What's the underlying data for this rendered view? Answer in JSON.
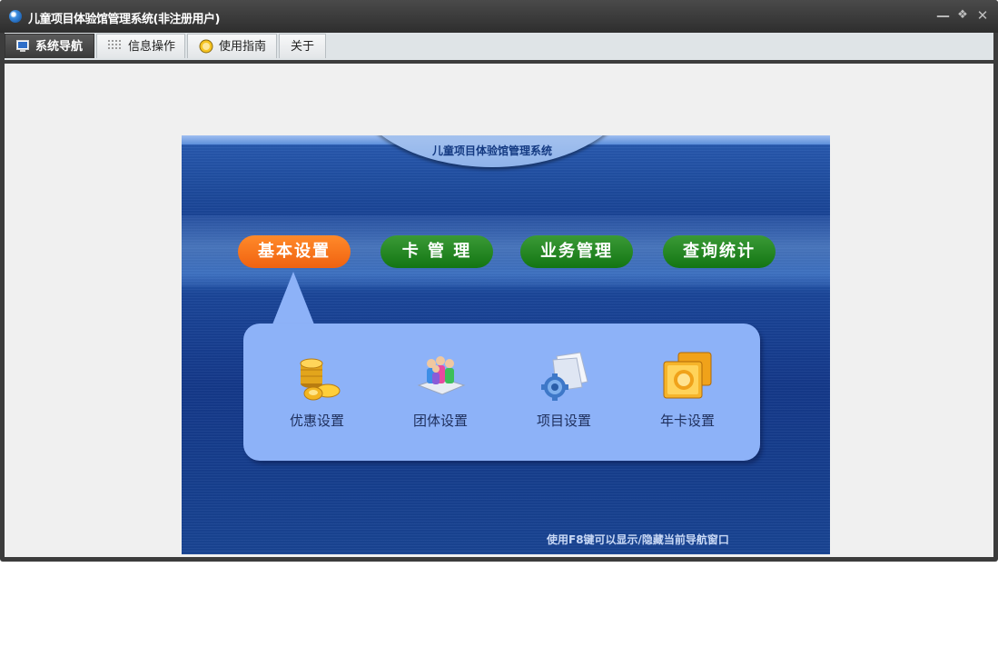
{
  "window": {
    "title": "儿童项目体验馆管理系统(非注册用户)"
  },
  "tabs": [
    {
      "label": "系统导航",
      "icon": "monitor-icon",
      "active": true
    },
    {
      "label": "信息操作",
      "icon": "grid-icon",
      "active": false
    },
    {
      "label": "使用指南",
      "icon": "help-icon",
      "active": false
    },
    {
      "label": "关于",
      "icon": "",
      "active": false
    }
  ],
  "panel": {
    "header": "儿童项目体验馆管理系统",
    "menu": [
      {
        "label": "基本设置",
        "active": true
      },
      {
        "label": "卡 管 理",
        "active": false
      },
      {
        "label": "业务管理",
        "active": false
      },
      {
        "label": "查询统计",
        "active": false
      }
    ],
    "items": [
      {
        "label": "优惠设置",
        "icon": "coins-icon"
      },
      {
        "label": "团体设置",
        "icon": "group-icon"
      },
      {
        "label": "项目设置",
        "icon": "gear-document-icon"
      },
      {
        "label": "年卡设置",
        "icon": "gold-card-icon"
      }
    ],
    "hint": "使用F8键可以显示/隐藏当前导航窗口"
  },
  "colors": {
    "active_menu": "#f06210",
    "menu": "#137513",
    "panel_blue": "#1a4496",
    "bubble": "#8db2f8"
  }
}
